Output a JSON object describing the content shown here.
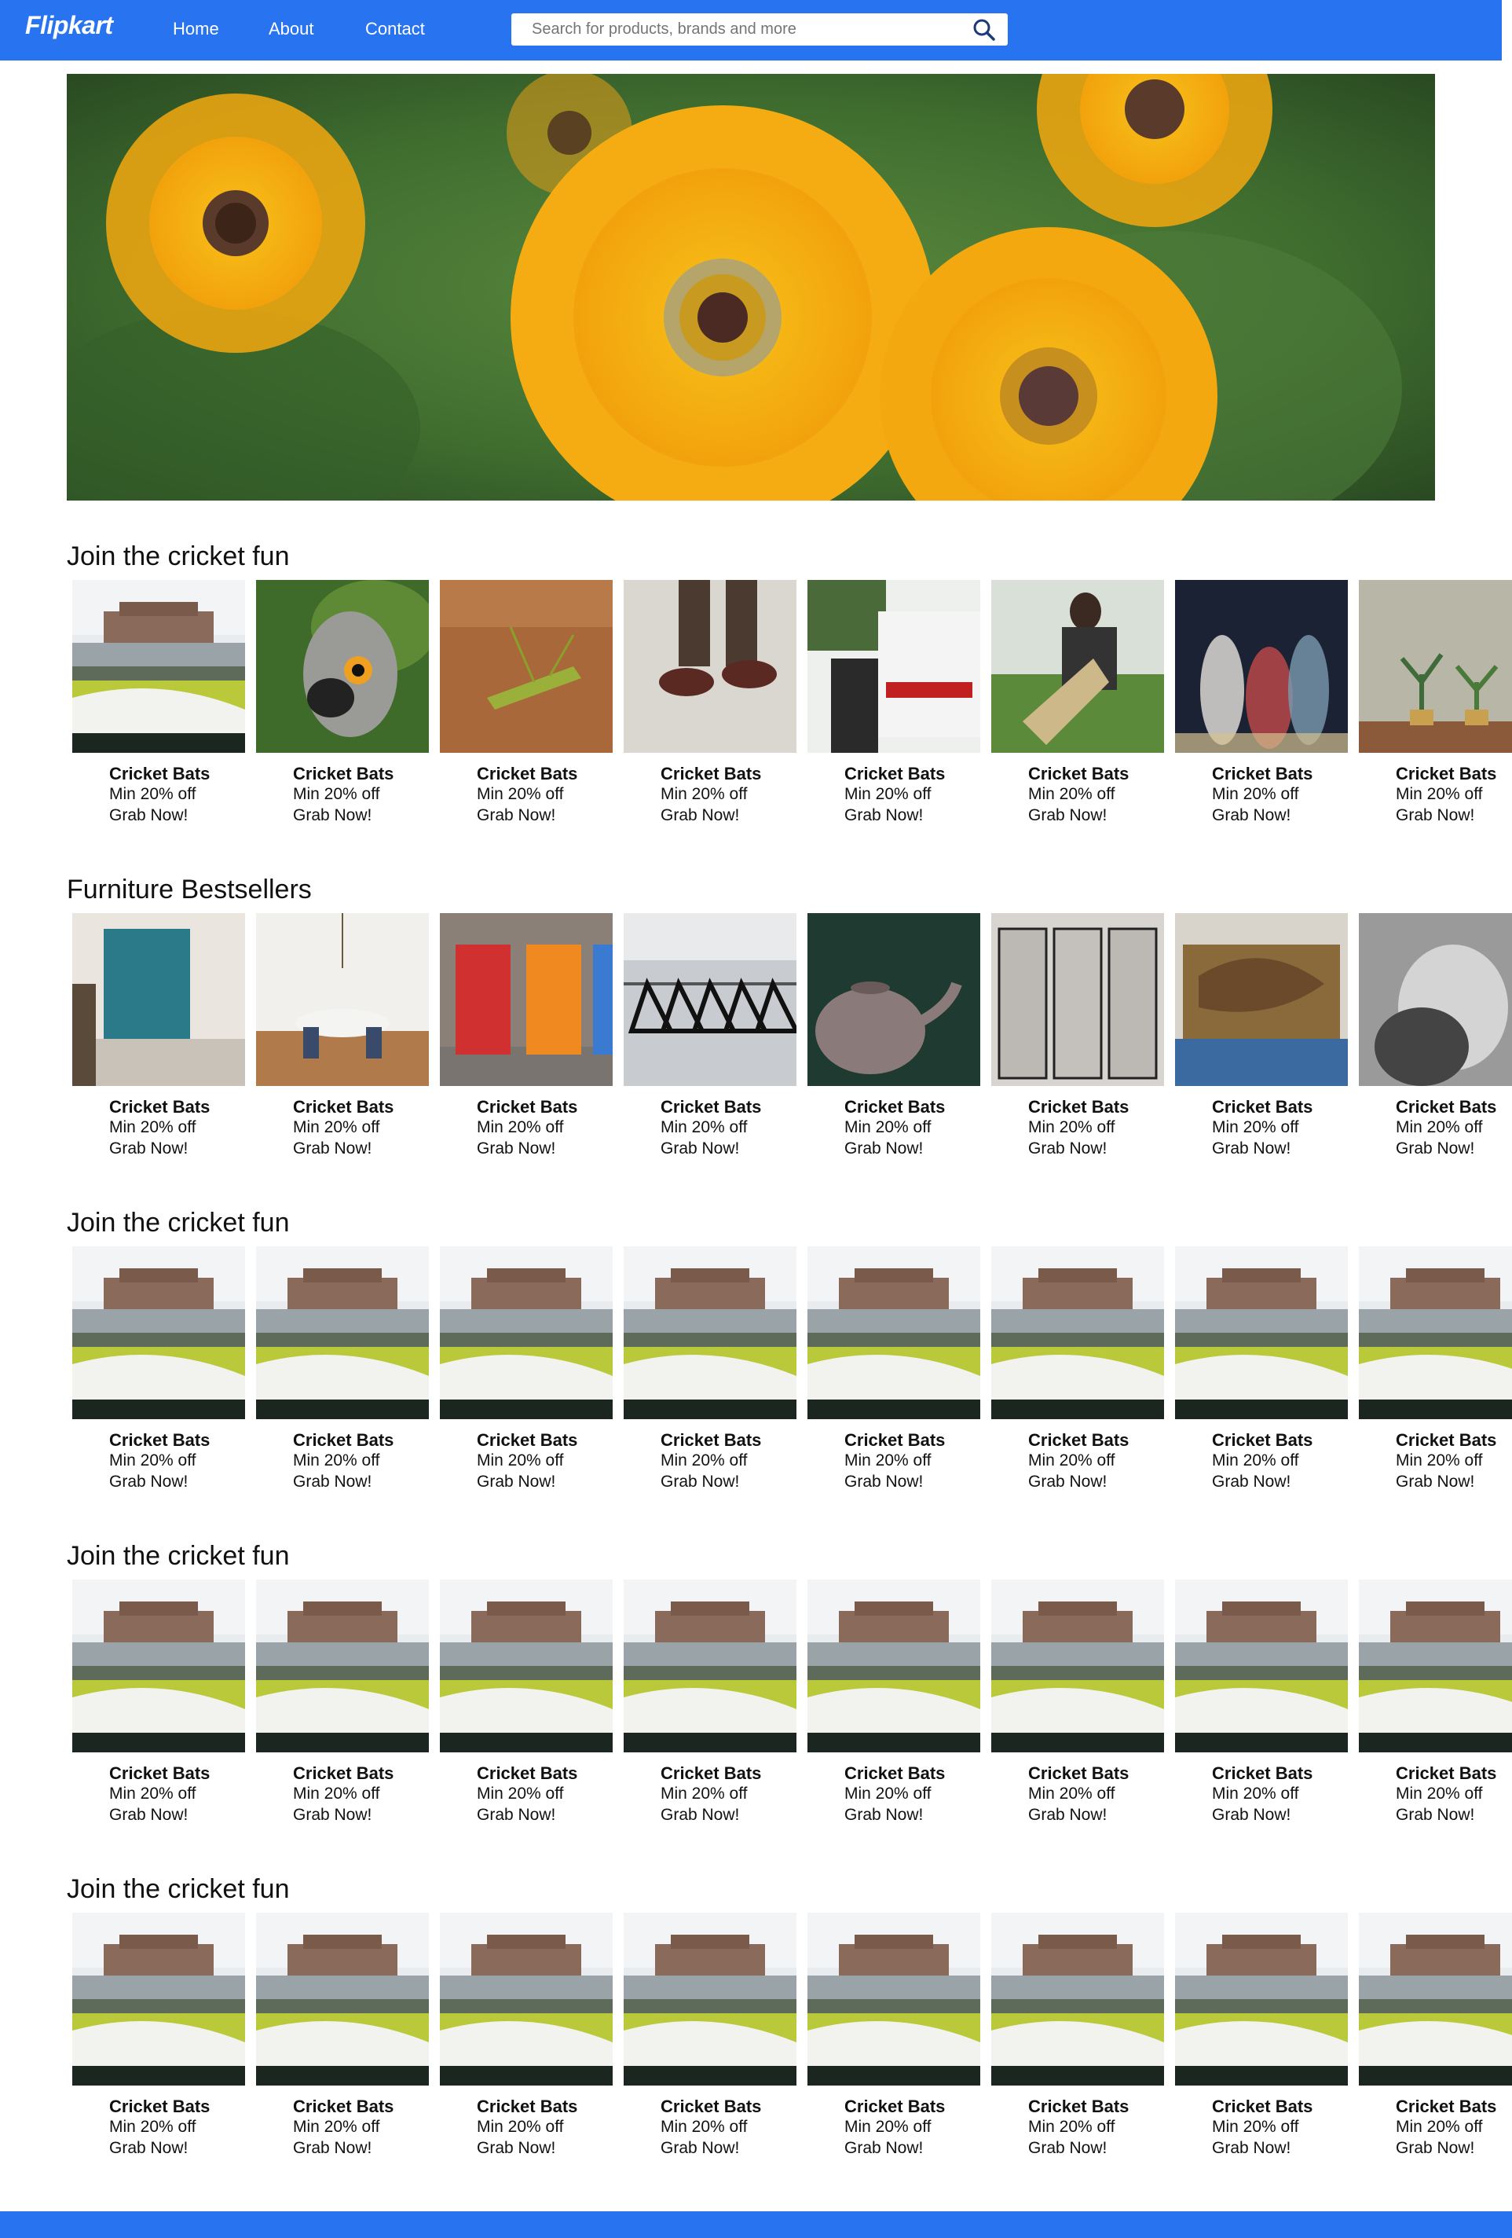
{
  "navbar": {
    "logo": "Flipkart",
    "links": [
      "Home",
      "About",
      "Contact"
    ],
    "search_placeholder": "Search for products, brands and more"
  },
  "hero": {
    "icon": "sunflowers-banner-image"
  },
  "sections": [
    {
      "title": "Join the cricket fun",
      "cards": [
        {
          "name": "Cricket Bats",
          "offer": "Min 20% off",
          "cta": "Grab Now!",
          "image": "stadium"
        },
        {
          "name": "Cricket Bats",
          "offer": "Min 20% off",
          "cta": "Grab Now!",
          "image": "lemur"
        },
        {
          "name": "Cricket Bats",
          "offer": "Min 20% off",
          "cta": "Grab Now!",
          "image": "grasshopper"
        },
        {
          "name": "Cricket Bats",
          "offer": "Min 20% off",
          "cta": "Grab Now!",
          "image": "shoes"
        },
        {
          "name": "Cricket Bats",
          "offer": "Min 20% off",
          "cta": "Grab Now!",
          "image": "firetruck"
        },
        {
          "name": "Cricket Bats",
          "offer": "Min 20% off",
          "cta": "Grab Now!",
          "image": "man-field"
        },
        {
          "name": "Cricket Bats",
          "offer": "Min 20% off",
          "cta": "Grab Now!",
          "image": "people-blur"
        },
        {
          "name": "Cricket Bats",
          "offer": "Min 20% off",
          "cta": "Grab Now!",
          "image": "plants"
        }
      ]
    },
    {
      "title": "Furniture Bestsellers",
      "cards": [
        {
          "name": "Cricket Bats",
          "offer": "Min 20% off",
          "cta": "Grab Now!",
          "image": "living-room"
        },
        {
          "name": "Cricket Bats",
          "offer": "Min 20% off",
          "cta": "Grab Now!",
          "image": "dining-room"
        },
        {
          "name": "Cricket Bats",
          "offer": "Min 20% off",
          "cta": "Grab Now!",
          "image": "chairs"
        },
        {
          "name": "Cricket Bats",
          "offer": "Min 20% off",
          "cta": "Grab Now!",
          "image": "hangers"
        },
        {
          "name": "Cricket Bats",
          "offer": "Min 20% off",
          "cta": "Grab Now!",
          "image": "kettle"
        },
        {
          "name": "Cricket Bats",
          "offer": "Min 20% off",
          "cta": "Grab Now!",
          "image": "lockers"
        },
        {
          "name": "Cricket Bats",
          "offer": "Min 20% off",
          "cta": "Grab Now!",
          "image": "mural"
        },
        {
          "name": "Cricket Bats",
          "offer": "Min 20% off",
          "cta": "Grab Now!",
          "image": "portrait"
        }
      ]
    },
    {
      "title": "Join the cricket fun",
      "cards": [
        {
          "name": "Cricket Bats",
          "offer": "Min 20% off",
          "cta": "Grab Now!",
          "image": "stadium"
        },
        {
          "name": "Cricket Bats",
          "offer": "Min 20% off",
          "cta": "Grab Now!",
          "image": "stadium"
        },
        {
          "name": "Cricket Bats",
          "offer": "Min 20% off",
          "cta": "Grab Now!",
          "image": "stadium"
        },
        {
          "name": "Cricket Bats",
          "offer": "Min 20% off",
          "cta": "Grab Now!",
          "image": "stadium"
        },
        {
          "name": "Cricket Bats",
          "offer": "Min 20% off",
          "cta": "Grab Now!",
          "image": "stadium"
        },
        {
          "name": "Cricket Bats",
          "offer": "Min 20% off",
          "cta": "Grab Now!",
          "image": "stadium"
        },
        {
          "name": "Cricket Bats",
          "offer": "Min 20% off",
          "cta": "Grab Now!",
          "image": "stadium"
        },
        {
          "name": "Cricket Bats",
          "offer": "Min 20% off",
          "cta": "Grab Now!",
          "image": "stadium"
        }
      ]
    },
    {
      "title": "Join the cricket fun",
      "cards": [
        {
          "name": "Cricket Bats",
          "offer": "Min 20% off",
          "cta": "Grab Now!",
          "image": "stadium"
        },
        {
          "name": "Cricket Bats",
          "offer": "Min 20% off",
          "cta": "Grab Now!",
          "image": "stadium"
        },
        {
          "name": "Cricket Bats",
          "offer": "Min 20% off",
          "cta": "Grab Now!",
          "image": "stadium"
        },
        {
          "name": "Cricket Bats",
          "offer": "Min 20% off",
          "cta": "Grab Now!",
          "image": "stadium"
        },
        {
          "name": "Cricket Bats",
          "offer": "Min 20% off",
          "cta": "Grab Now!",
          "image": "stadium"
        },
        {
          "name": "Cricket Bats",
          "offer": "Min 20% off",
          "cta": "Grab Now!",
          "image": "stadium"
        },
        {
          "name": "Cricket Bats",
          "offer": "Min 20% off",
          "cta": "Grab Now!",
          "image": "stadium"
        },
        {
          "name": "Cricket Bats",
          "offer": "Min 20% off",
          "cta": "Grab Now!",
          "image": "stadium"
        }
      ]
    },
    {
      "title": "Join the cricket fun",
      "cards": [
        {
          "name": "Cricket Bats",
          "offer": "Min 20% off",
          "cta": "Grab Now!",
          "image": "stadium"
        },
        {
          "name": "Cricket Bats",
          "offer": "Min 20% off",
          "cta": "Grab Now!",
          "image": "stadium"
        },
        {
          "name": "Cricket Bats",
          "offer": "Min 20% off",
          "cta": "Grab Now!",
          "image": "stadium"
        },
        {
          "name": "Cricket Bats",
          "offer": "Min 20% off",
          "cta": "Grab Now!",
          "image": "stadium"
        },
        {
          "name": "Cricket Bats",
          "offer": "Min 20% off",
          "cta": "Grab Now!",
          "image": "stadium"
        },
        {
          "name": "Cricket Bats",
          "offer": "Min 20% off",
          "cta": "Grab Now!",
          "image": "stadium"
        },
        {
          "name": "Cricket Bats",
          "offer": "Min 20% off",
          "cta": "Grab Now!",
          "image": "stadium"
        },
        {
          "name": "Cricket Bats",
          "offer": "Min 20% off",
          "cta": "Grab Now!",
          "image": "stadium"
        }
      ]
    }
  ],
  "colors": {
    "brand": "#2874f0",
    "text": "#111111",
    "background": "#ffffff"
  }
}
